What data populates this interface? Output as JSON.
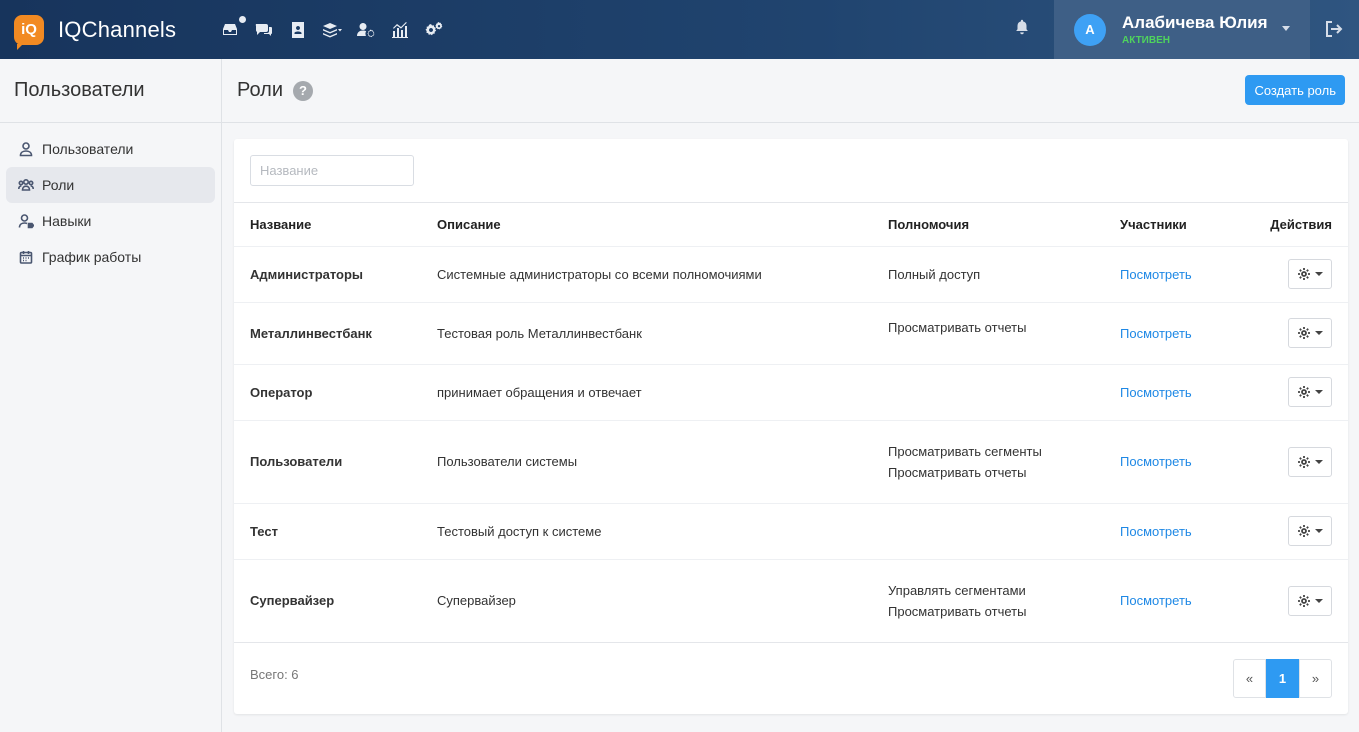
{
  "app": {
    "logo_badge": "iQ",
    "name": "IQChannels"
  },
  "nav_icons": [
    "inbox-icon",
    "chats-icon",
    "contacts-icon",
    "layers-icon",
    "users-settings-icon",
    "analytics-icon",
    "settings-icon"
  ],
  "user": {
    "avatar_letter": "А",
    "name": "Алабичева Юлия",
    "status": "АКТИВЕН"
  },
  "sidebar": {
    "title": "Пользователи",
    "items": [
      {
        "label": "Пользователи",
        "icon": "user-icon",
        "active": false
      },
      {
        "label": "Роли",
        "icon": "group-icon",
        "active": true
      },
      {
        "label": "Навыки",
        "icon": "user-tag-icon",
        "active": false
      },
      {
        "label": "График работы",
        "icon": "calendar-icon",
        "active": false
      }
    ]
  },
  "main": {
    "title": "Роли",
    "help": "?",
    "create_label": "Создать роль",
    "search_placeholder": "Название",
    "columns": {
      "name": "Название",
      "description": "Описание",
      "permissions": "Полномочия",
      "members": "Участники",
      "actions": "Действия"
    },
    "rows": [
      {
        "name": "Администраторы",
        "description": "Системные администраторы со всеми полномочиями",
        "perm1": "Полный доступ",
        "perm2": "",
        "members": "Посмотреть"
      },
      {
        "name": "Металлинвестбанк",
        "description": "Тестовая роль Металлинвестбанк",
        "perm1": "Просматривать отчеты",
        "perm2": "",
        "members": "Посмотреть"
      },
      {
        "name": "Оператор",
        "description": "принимает обращения и отвечает",
        "perm1": "",
        "perm2": "",
        "members": "Посмотреть"
      },
      {
        "name": "Пользователи",
        "description": "Пользователи системы",
        "perm1": "Просматривать сегменты",
        "perm2": "Просматривать отчеты",
        "members": "Посмотреть"
      },
      {
        "name": "Тест",
        "description": "Тестовый доступ к системе",
        "perm1": "",
        "perm2": "",
        "members": "Посмотреть"
      },
      {
        "name": "Супервайзер",
        "description": "Супервайзер",
        "perm1": "Управлять сегментами",
        "perm2": "Просматривать отчеты",
        "members": "Посмотреть"
      }
    ],
    "total": "Всего: 6",
    "pager": {
      "prev": "«",
      "current": "1",
      "next": "»"
    }
  },
  "colors": {
    "accent": "#2e9af2",
    "link": "#1e88e5",
    "status_active": "#4fd35d",
    "topbar": "#17345c"
  }
}
